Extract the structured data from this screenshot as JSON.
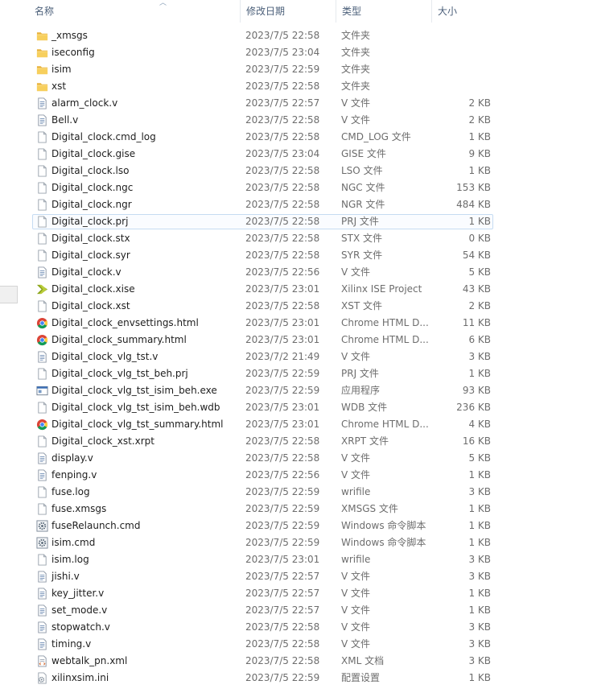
{
  "columns": {
    "name": "名称",
    "date": "修改日期",
    "type": "类型",
    "size": "大小"
  },
  "files": [
    {
      "name": "_xmsgs",
      "date": "2023/7/5 22:58",
      "type": "文件夹",
      "size": "",
      "icon": "folder-icon"
    },
    {
      "name": "iseconfig",
      "date": "2023/7/5 23:04",
      "type": "文件夹",
      "size": "",
      "icon": "folder-icon"
    },
    {
      "name": "isim",
      "date": "2023/7/5 22:59",
      "type": "文件夹",
      "size": "",
      "icon": "folder-icon"
    },
    {
      "name": "xst",
      "date": "2023/7/5 22:58",
      "type": "文件夹",
      "size": "",
      "icon": "folder-icon"
    },
    {
      "name": "alarm_clock.v",
      "date": "2023/7/5 22:57",
      "type": "V 文件",
      "size": "2 KB",
      "icon": "text-file-icon"
    },
    {
      "name": "Bell.v",
      "date": "2023/7/5 22:58",
      "type": "V 文件",
      "size": "2 KB",
      "icon": "text-file-icon"
    },
    {
      "name": "Digital_clock.cmd_log",
      "date": "2023/7/5 22:58",
      "type": "CMD_LOG 文件",
      "size": "1 KB",
      "icon": "blank-file-icon"
    },
    {
      "name": "Digital_clock.gise",
      "date": "2023/7/5 23:04",
      "type": "GISE 文件",
      "size": "9 KB",
      "icon": "blank-file-icon"
    },
    {
      "name": "Digital_clock.lso",
      "date": "2023/7/5 22:58",
      "type": "LSO 文件",
      "size": "1 KB",
      "icon": "blank-file-icon"
    },
    {
      "name": "Digital_clock.ngc",
      "date": "2023/7/5 22:58",
      "type": "NGC 文件",
      "size": "153 KB",
      "icon": "blank-file-icon"
    },
    {
      "name": "Digital_clock.ngr",
      "date": "2023/7/5 22:58",
      "type": "NGR 文件",
      "size": "484 KB",
      "icon": "blank-file-icon"
    },
    {
      "name": "Digital_clock.prj",
      "date": "2023/7/5 22:58",
      "type": "PRJ 文件",
      "size": "1 KB",
      "icon": "blank-file-icon",
      "selected": true
    },
    {
      "name": "Digital_clock.stx",
      "date": "2023/7/5 22:58",
      "type": "STX 文件",
      "size": "0 KB",
      "icon": "blank-file-icon"
    },
    {
      "name": "Digital_clock.syr",
      "date": "2023/7/5 22:58",
      "type": "SYR 文件",
      "size": "54 KB",
      "icon": "blank-file-icon"
    },
    {
      "name": "Digital_clock.v",
      "date": "2023/7/5 22:56",
      "type": "V 文件",
      "size": "5 KB",
      "icon": "text-file-icon"
    },
    {
      "name": "Digital_clock.xise",
      "date": "2023/7/5 23:01",
      "type": "Xilinx ISE Project",
      "size": "43 KB",
      "icon": "xilinx-icon"
    },
    {
      "name": "Digital_clock.xst",
      "date": "2023/7/5 22:58",
      "type": "XST 文件",
      "size": "2 KB",
      "icon": "blank-file-icon"
    },
    {
      "name": "Digital_clock_envsettings.html",
      "date": "2023/7/5 23:01",
      "type": "Chrome HTML D...",
      "size": "11 KB",
      "icon": "chrome-icon"
    },
    {
      "name": "Digital_clock_summary.html",
      "date": "2023/7/5 23:01",
      "type": "Chrome HTML D...",
      "size": "6 KB",
      "icon": "chrome-icon"
    },
    {
      "name": "Digital_clock_vlg_tst.v",
      "date": "2023/7/2 21:49",
      "type": "V 文件",
      "size": "3 KB",
      "icon": "text-file-icon"
    },
    {
      "name": "Digital_clock_vlg_tst_beh.prj",
      "date": "2023/7/5 22:59",
      "type": "PRJ 文件",
      "size": "1 KB",
      "icon": "blank-file-icon"
    },
    {
      "name": "Digital_clock_vlg_tst_isim_beh.exe",
      "date": "2023/7/5 22:59",
      "type": "应用程序",
      "size": "93 KB",
      "icon": "exe-icon"
    },
    {
      "name": "Digital_clock_vlg_tst_isim_beh.wdb",
      "date": "2023/7/5 23:01",
      "type": "WDB 文件",
      "size": "236 KB",
      "icon": "blank-file-icon"
    },
    {
      "name": "Digital_clock_vlg_tst_summary.html",
      "date": "2023/7/5 23:01",
      "type": "Chrome HTML D...",
      "size": "4 KB",
      "icon": "chrome-icon"
    },
    {
      "name": "Digital_clock_xst.xrpt",
      "date": "2023/7/5 22:58",
      "type": "XRPT 文件",
      "size": "16 KB",
      "icon": "blank-file-icon"
    },
    {
      "name": "display.v",
      "date": "2023/7/5 22:58",
      "type": "V 文件",
      "size": "5 KB",
      "icon": "text-file-icon"
    },
    {
      "name": "fenping.v",
      "date": "2023/7/5 22:56",
      "type": "V 文件",
      "size": "1 KB",
      "icon": "text-file-icon"
    },
    {
      "name": "fuse.log",
      "date": "2023/7/5 22:59",
      "type": "wrifile",
      "size": "3 KB",
      "icon": "blank-file-icon"
    },
    {
      "name": "fuse.xmsgs",
      "date": "2023/7/5 22:59",
      "type": "XMSGS 文件",
      "size": "1 KB",
      "icon": "blank-file-icon"
    },
    {
      "name": "fuseRelaunch.cmd",
      "date": "2023/7/5 22:59",
      "type": "Windows 命令脚本",
      "size": "1 KB",
      "icon": "cmd-gear-icon"
    },
    {
      "name": "isim.cmd",
      "date": "2023/7/5 22:59",
      "type": "Windows 命令脚本",
      "size": "1 KB",
      "icon": "cmd-gear-icon"
    },
    {
      "name": "isim.log",
      "date": "2023/7/5 23:01",
      "type": "wrifile",
      "size": "3 KB",
      "icon": "blank-file-icon"
    },
    {
      "name": "jishi.v",
      "date": "2023/7/5 22:57",
      "type": "V 文件",
      "size": "3 KB",
      "icon": "text-file-icon"
    },
    {
      "name": "key_jitter.v",
      "date": "2023/7/5 22:57",
      "type": "V 文件",
      "size": "1 KB",
      "icon": "text-file-icon"
    },
    {
      "name": "set_mode.v",
      "date": "2023/7/5 22:57",
      "type": "V 文件",
      "size": "1 KB",
      "icon": "text-file-icon"
    },
    {
      "name": "stopwatch.v",
      "date": "2023/7/5 22:58",
      "type": "V 文件",
      "size": "3 KB",
      "icon": "text-file-icon"
    },
    {
      "name": "timing.v",
      "date": "2023/7/5 22:58",
      "type": "V 文件",
      "size": "3 KB",
      "icon": "text-file-icon"
    },
    {
      "name": "webtalk_pn.xml",
      "date": "2023/7/5 22:58",
      "type": "XML 文档",
      "size": "3 KB",
      "icon": "xml-file-icon"
    },
    {
      "name": "xilinxsim.ini",
      "date": "2023/7/5 22:59",
      "type": "配置设置",
      "size": "1 KB",
      "icon": "ini-gear-icon"
    }
  ]
}
